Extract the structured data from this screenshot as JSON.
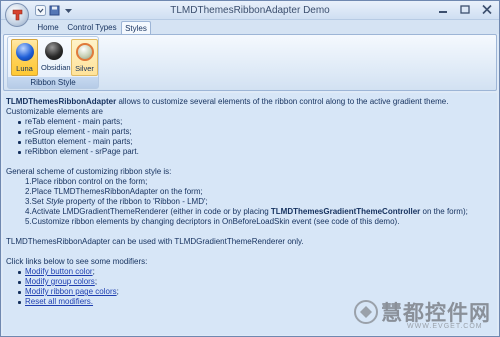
{
  "window": {
    "title": "TLMDThemesRibbonAdapter Demo"
  },
  "tabs": [
    {
      "label": "Home"
    },
    {
      "label": "Control Types"
    },
    {
      "label": "Styles"
    }
  ],
  "ribbon": {
    "group_caption": "Ribbon Style",
    "buttons": [
      {
        "label": "Luna",
        "color": "#1f5fd8"
      },
      {
        "label": "Obsidian",
        "color": "#2b2b2b"
      },
      {
        "label": "Silver",
        "color": "#c9d2b8"
      }
    ]
  },
  "content": {
    "intro_bold": "TLMDThemesRibbonAdapter",
    "intro_rest": " allows to customize several elements of the ribbon control along to the active gradient theme.",
    "customizable": "Customizable elements are",
    "elements": [
      "reTab element - main parts;",
      "reGroup element - main parts;",
      "reButton element - main parts;",
      "reRibbon element - srPage part."
    ],
    "scheme_heading": "General scheme of customizing ribbon style is:",
    "step1": "1.Place ribbon control on the form;",
    "step2": "2.Place TLMDThemesRibbonAdapter on the form;",
    "step3_a": "3.Set ",
    "step3_italic": "Style",
    "step3_b": " property of the ribbon to 'Ribbon - LMD';",
    "step4_a": "4.Activate LMDGradientThemeRenderer (either in code or by placing ",
    "step4_bold": "TLMDThemesGradientThemeController",
    "step4_b": " on the form);",
    "step5": "5.Customize ribbon elements by changing decriptors in OnBeforeLoadSkin event (see code of this demo).",
    "usage": "TLMDThemesRibbonAdapter can be used with TLMDGradientThemeRenderer only.",
    "links_intro": "Click links below to see some modifiers:",
    "links": [
      "Modify button color",
      "Modify group colors",
      "Modify ribbon page colors",
      "Reset all modifiers."
    ],
    "links_suffix": [
      ";",
      ";",
      ";",
      ""
    ]
  },
  "watermark": {
    "text": "慧都控件网",
    "url": "WWW.EVGET.COM"
  }
}
